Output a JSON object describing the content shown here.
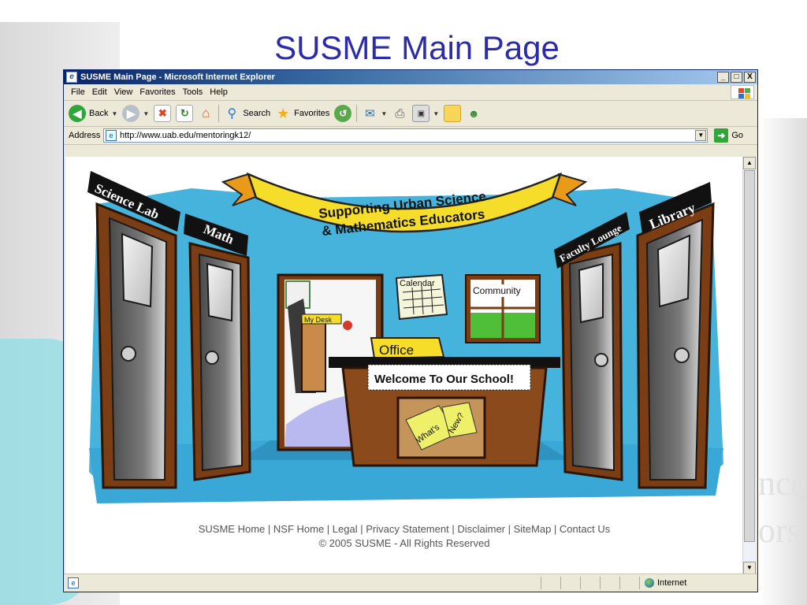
{
  "slide": {
    "title": "SUSME Main Page",
    "watermark_lines": [
      "nce",
      "ors"
    ]
  },
  "browser": {
    "window_title": "SUSME Main Page - Microsoft Internet Explorer",
    "window_controls": [
      "_",
      "□",
      "X"
    ],
    "menu": [
      "File",
      "Edit",
      "View",
      "Favorites",
      "Tools",
      "Help"
    ],
    "toolbar": {
      "back": "Back",
      "search": "Search",
      "favorites": "Favorites"
    },
    "address": {
      "label": "Address",
      "url": "http://www.uab.edu/mentoringk12/",
      "go": "Go"
    },
    "status": {
      "zone": "Internet"
    }
  },
  "page": {
    "banner": {
      "line1": "Supporting Urban Science",
      "line2": "& Mathematics Educators"
    },
    "doors": {
      "science": "Science Lab",
      "math": "Math",
      "faculty": "Faculty Lounge",
      "library": "Library"
    },
    "labels": {
      "calendar": "Calendar",
      "community": "Community",
      "my_desk": "My Desk",
      "office": "Office",
      "welcome": "Welcome To Our School!",
      "whats": "What's",
      "new": "New?"
    },
    "footer": {
      "links": [
        "SUSME Home",
        "NSF Home",
        "Legal",
        "Privacy Statement",
        "Disclaimer",
        "SiteMap",
        "Contact Us"
      ],
      "copyright": "© 2005 SUSME - All Rights Reserved"
    }
  },
  "colors": {
    "wall_blue": "#45b3dc",
    "door_frame": "#7a3d14",
    "door_gray": "#6f6f6f",
    "banner_yellow": "#f6dd2a",
    "desk_brown": "#8b4a1c",
    "title_blue": "#2c2ca8"
  }
}
